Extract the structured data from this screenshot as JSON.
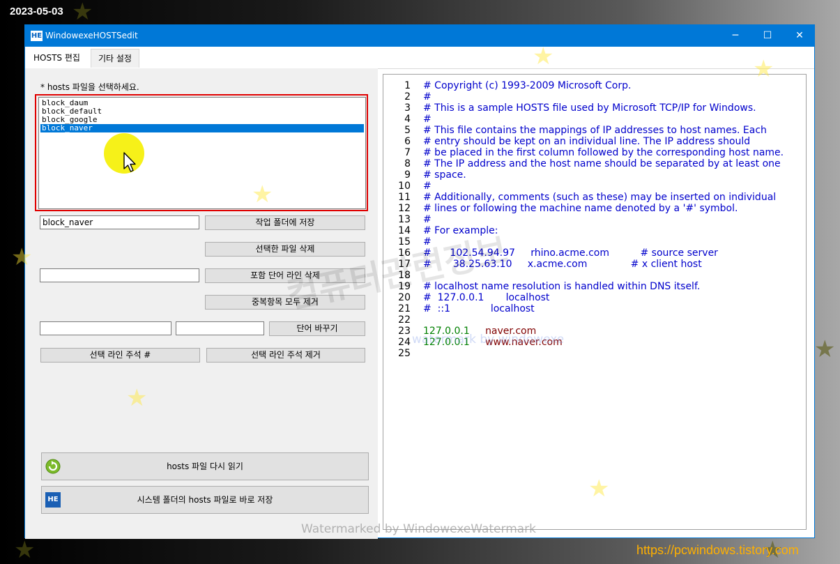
{
  "overlay": {
    "date": "2023-05-03",
    "url_watermark": "https://pcwindows.tistory.com",
    "watermark_center": "Watermarked by WindowexeWatermark",
    "watermark_mid": "watermark by windowexe",
    "watermark_korean": "컴퓨터관련정보"
  },
  "window": {
    "title": "WindowexeHOSTSedit",
    "icon_label": "HE",
    "minimize_glyph": "─",
    "maximize_glyph": "☐",
    "close_glyph": "✕"
  },
  "tabs": [
    {
      "label": "HOSTS 편집",
      "active": true
    },
    {
      "label": "기타 설정",
      "active": false
    }
  ],
  "left": {
    "prompt": "* hosts 파일을 선택하세요.",
    "files": [
      "block_daum",
      "block_default",
      "block_google",
      "block_naver"
    ],
    "selected_file": "block_naver",
    "filename_value": "block_naver",
    "save_to_folder": "작업 폴더에 저장",
    "delete_selected": "선택한 파일 삭제",
    "word_filter_value": "",
    "delete_lines_with_word": "포함 단어 라인 삭제",
    "remove_duplicates": "중복항목 모두 제거",
    "find_value": "",
    "replace_value": "",
    "replace_word": "단어 바꾸기",
    "comment_selected": "선택 라인 주석 #",
    "uncomment_selected": "선택 라인 주석 제거",
    "reload_hosts": "hosts 파일 다시 읽기",
    "reload_icon": "refresh-icon",
    "save_system_hosts": "시스템 폴더의 hosts 파일로 바로 저장",
    "save_icon_label": "HE"
  },
  "editor": {
    "lines": [
      {
        "n": "1",
        "text": "# Copyright (c) 1993-2009 Microsoft Corp."
      },
      {
        "n": "2",
        "text": "#"
      },
      {
        "n": "3",
        "text": "# This is a sample HOSTS file used by Microsoft TCP/IP for Windows."
      },
      {
        "n": "4",
        "text": "#"
      },
      {
        "n": "5",
        "text": "# This file contains the mappings of IP addresses to host names. Each"
      },
      {
        "n": "6",
        "text": "# entry should be kept on an individual line. The IP address should"
      },
      {
        "n": "7",
        "text": "# be placed in the first column followed by the corresponding host name."
      },
      {
        "n": "8",
        "text": "# The IP address and the host name should be separated by at least one"
      },
      {
        "n": "9",
        "text": "# space."
      },
      {
        "n": "10",
        "text": "#"
      },
      {
        "n": "11",
        "text": "# Additionally, comments (such as these) may be inserted on individual"
      },
      {
        "n": "12",
        "text": "# lines or following the machine name denoted by a '#' symbol."
      },
      {
        "n": "13",
        "text": "#"
      },
      {
        "n": "14",
        "text": "# For example:"
      },
      {
        "n": "15",
        "text": "#"
      },
      {
        "n": "16",
        "text": "#      102.54.94.97     rhino.acme.com          # source server"
      },
      {
        "n": "17",
        "text": "#       38.25.63.10     x.acme.com              # x client host"
      },
      {
        "n": "18",
        "text": ""
      },
      {
        "n": "19",
        "text": "# localhost name resolution is handled within DNS itself."
      },
      {
        "n": "20",
        "text": "#  127.0.0.1       localhost"
      },
      {
        "n": "21",
        "text": "#  ::1             localhost"
      },
      {
        "n": "22",
        "text": ""
      },
      {
        "n": "23",
        "ip": "127.0.0.1",
        "host": "naver.com"
      },
      {
        "n": "24",
        "ip": "127.0.0.1",
        "host": "www.naver.com"
      },
      {
        "n": "25",
        "text": ""
      }
    ]
  }
}
